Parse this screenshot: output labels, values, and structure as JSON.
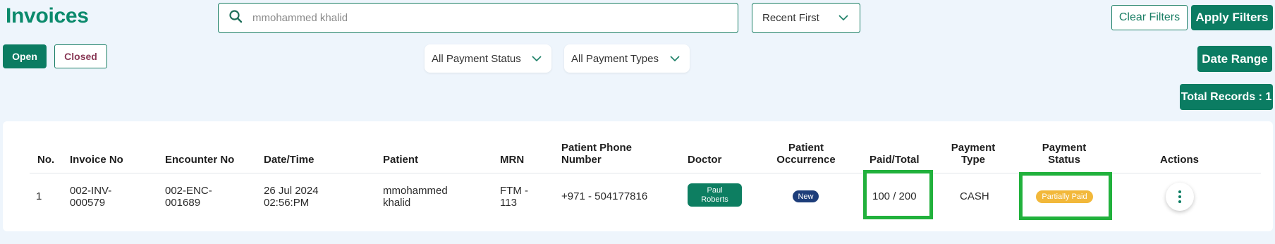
{
  "page": {
    "title": "Invoices"
  },
  "search": {
    "value": "mmohammed khalid",
    "placeholder": "mmohammed khalid"
  },
  "sort": {
    "label": "Recent First"
  },
  "filters": {
    "clear_label": "Clear Filters",
    "apply_label": "Apply Filters",
    "payment_status": "All Payment Status",
    "payment_types": "All Payment Types",
    "date_range_label": "Date Range"
  },
  "tabs": {
    "open": "Open",
    "closed": "Closed"
  },
  "total_records": "Total Records : 1",
  "table": {
    "headers": {
      "no": "No.",
      "invoice_no": "Invoice No",
      "encounter_no": "Encounter No",
      "date_time": "Date/Time",
      "patient": "Patient",
      "mrn": "MRN",
      "phone_line1": "Patient Phone",
      "phone_line2": "Number",
      "doctor": "Doctor",
      "occurrence_line1": "Patient",
      "occurrence_line2": "Occurrence",
      "paid_total": "Paid/Total",
      "payment_type_line1": "Payment",
      "payment_type_line2": "Type",
      "payment_status_line1": "Payment",
      "payment_status_line2": "Status",
      "actions": "Actions"
    },
    "rows": [
      {
        "no": "1",
        "invoice_no_line1": "002-INV-",
        "invoice_no_line2": "000579",
        "encounter_no_line1": "002-ENC-",
        "encounter_no_line2": "001689",
        "date_line1": "26 Jul 2024",
        "date_line2": "02:56:PM",
        "patient_line1": "mmohammed",
        "patient_line2": "khalid",
        "mrn_line1": "FTM -",
        "mrn_line2": "113",
        "phone": "+971 - 504177816",
        "doctor_line1": "Paul",
        "doctor_line2": "Roberts",
        "occurrence": "New",
        "paid_total": "100 / 200",
        "payment_type": "CASH",
        "payment_status": "Partially Paid"
      }
    ]
  },
  "colors": {
    "brand": "#0b7c62",
    "background": "#eef5fc",
    "status_partial": "#f2b83a",
    "occurrence_new": "#1d3d7a",
    "highlight": "#21b13c"
  },
  "icons": {
    "search": "search-icon",
    "chevron": "chevron-down-icon",
    "actions": "kebab-menu-icon"
  }
}
